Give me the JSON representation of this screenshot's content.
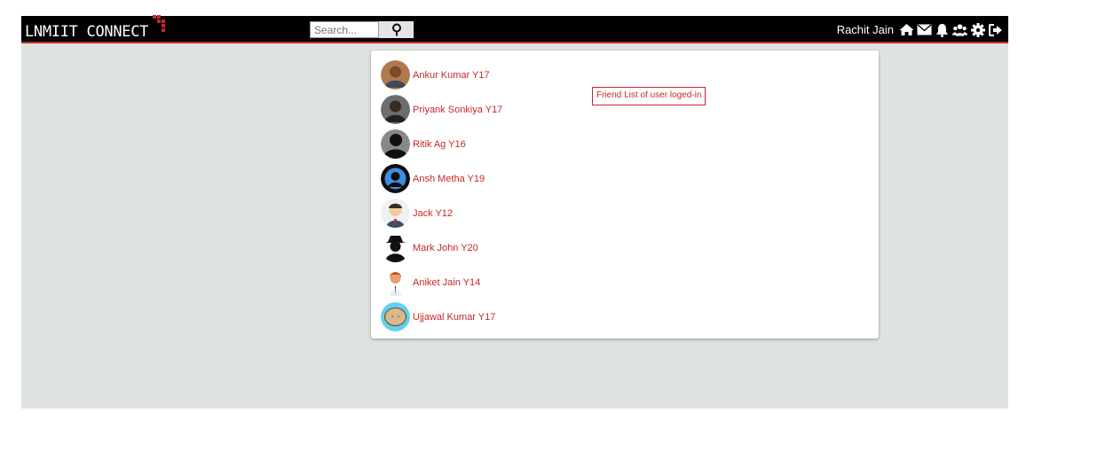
{
  "header": {
    "logo_text": "LNMIIT CONNECT",
    "search_placeholder": "Search...",
    "user_name": "Rachit Jain",
    "nav_icons": [
      "home-icon",
      "envelope-icon",
      "bell-icon",
      "users-icon",
      "gear-icon",
      "logout-icon"
    ]
  },
  "colors": {
    "navbar": "#000000",
    "accent": "#c62828",
    "page_background": "#dfe3df"
  },
  "friends": [
    {
      "name": "Ankur Kumar Y17",
      "avatar": "photo-avatar"
    },
    {
      "name": "Priyank Sonkiya Y17",
      "avatar": "photo-avatar"
    },
    {
      "name": "Ritik Ag Y16",
      "avatar": "silhouette-avatar"
    },
    {
      "name": "Ansh Metha Y19",
      "avatar": "blue-default-avatar"
    },
    {
      "name": "Jack Y12",
      "avatar": "cartoon-avatar"
    },
    {
      "name": "Mark John Y20",
      "avatar": "spy-avatar"
    },
    {
      "name": "Aniket Jain Y14",
      "avatar": "operator-avatar"
    },
    {
      "name": "Ujjawal Kumar Y17",
      "avatar": "emoji-avatar"
    }
  ],
  "annotation": "Friend List of user loged-in"
}
